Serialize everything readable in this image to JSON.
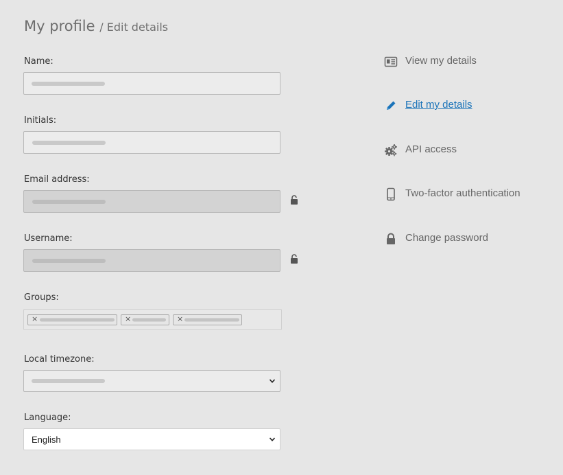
{
  "header": {
    "title": "My profile",
    "subtitle": "/ Edit details"
  },
  "form": {
    "name_label": "Name:",
    "initials_label": "Initials:",
    "email_label": "Email address:",
    "username_label": "Username:",
    "groups_label": "Groups:",
    "timezone_label": "Local timezone:",
    "language_label": "Language:",
    "language_value": "English",
    "group_remove_glyph": "×"
  },
  "menu": {
    "items": [
      {
        "label": "View my details",
        "icon": "id-card-icon"
      },
      {
        "label": "Edit my details",
        "icon": "pencil-icon"
      },
      {
        "label": "API access",
        "icon": "gears-icon"
      },
      {
        "label": "Two-factor authentication",
        "icon": "mobile-phone-icon"
      },
      {
        "label": "Change password",
        "icon": "lock-icon"
      }
    ]
  },
  "colors": {
    "background": "#e6e6e6",
    "active_link": "#1a73b9",
    "icon": "#666666"
  }
}
